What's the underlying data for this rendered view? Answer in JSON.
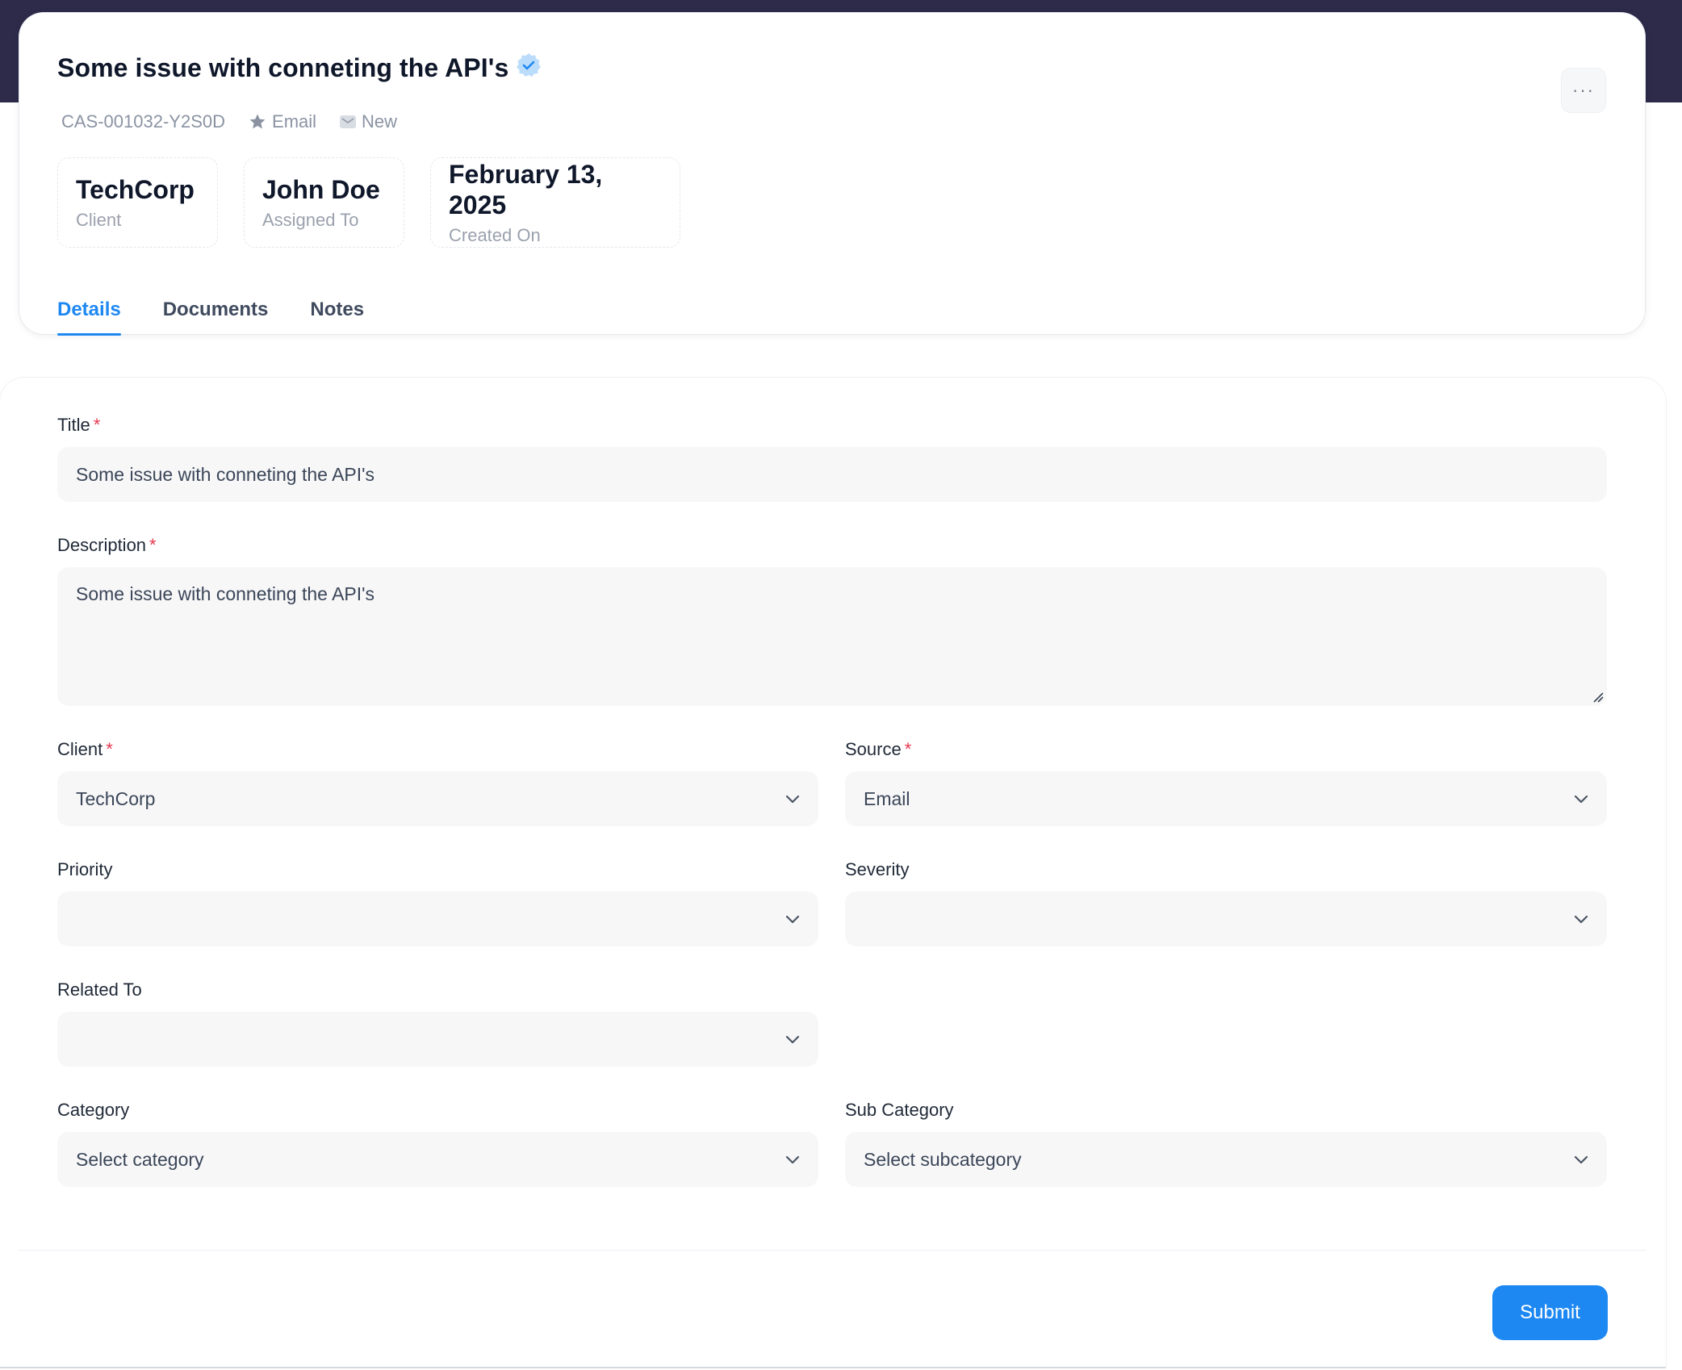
{
  "case": {
    "title": "Some issue with conneting the API's",
    "id": "CAS-001032-Y2S0D",
    "source": "Email",
    "status": "New",
    "more_label": "···"
  },
  "stats": [
    {
      "value": "TechCorp",
      "label": "Client"
    },
    {
      "value": "John Doe",
      "label": "Assigned To"
    },
    {
      "value": "February 13, 2025",
      "label": "Created On"
    }
  ],
  "tabs": [
    {
      "label": "Details",
      "active": true
    },
    {
      "label": "Documents",
      "active": false
    },
    {
      "label": "Notes",
      "active": false
    }
  ],
  "form": {
    "title": {
      "label": "Title",
      "required": "*",
      "value": "Some issue with conneting the API's"
    },
    "description": {
      "label": "Description",
      "required": "*",
      "value": "Some issue with conneting the API's"
    },
    "client": {
      "label": "Client",
      "required": "*",
      "value": "TechCorp"
    },
    "source": {
      "label": "Source",
      "required": "*",
      "value": "Email"
    },
    "priority": {
      "label": "Priority",
      "value": ""
    },
    "severity": {
      "label": "Severity",
      "value": ""
    },
    "related_to": {
      "label": "Related To",
      "value": ""
    },
    "category": {
      "label": "Category",
      "value": "Select category"
    },
    "sub_category": {
      "label": "Sub Category",
      "value": "Select subcategory"
    },
    "submit_label": "Submit"
  },
  "colors": {
    "accent": "#1e88f2",
    "topbar": "#2d2a4a",
    "required": "#e5374d"
  },
  "icons": {
    "verified": "verified-badge-icon",
    "source": "star-icon",
    "status": "envelope-icon",
    "select": "chevron-down-icon"
  }
}
